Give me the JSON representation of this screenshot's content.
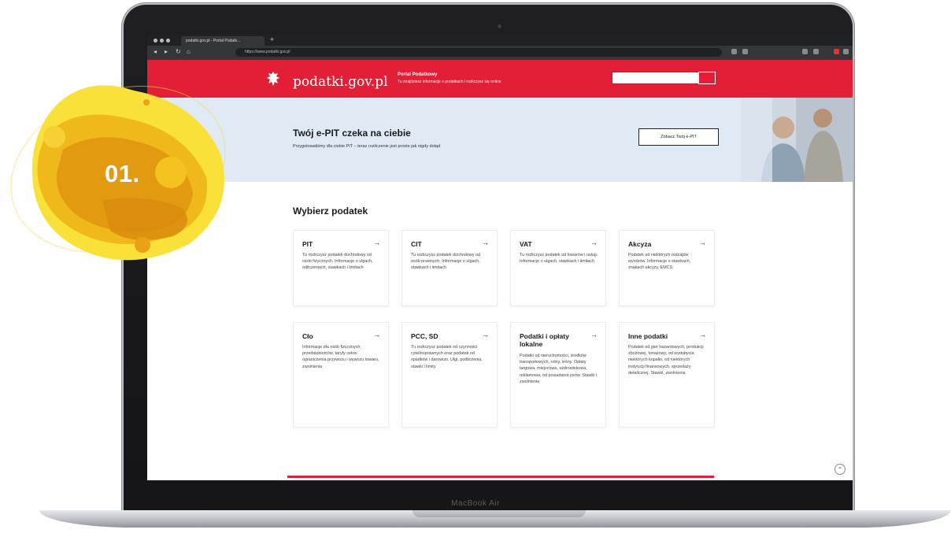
{
  "badge": {
    "label": "01."
  },
  "device": {
    "model_label": "MacBook Air"
  },
  "browser": {
    "tab_title": "podatki.gov.pl - Portal Podatk...",
    "new_tab": "+",
    "url": "https://www.podatki.gov.pl"
  },
  "site": {
    "logo_text": "podatki.gov.pl",
    "portal_title": "Portal Podatkowy",
    "portal_subtitle": "Tu znajdziesz informacje o podatkach i rozliczysz się online"
  },
  "banner": {
    "title": "Twój e-PIT czeka na ciebie",
    "subtitle": "Przygotowaliśmy dla ciebie PIT – teraz rozliczenie jest proste jak nigdy dotąd",
    "button_label": "Zobacz Twój e-PIT"
  },
  "section": {
    "title": "Wybierz podatek"
  },
  "cards": [
    {
      "title": "PIT",
      "arrow": "→",
      "desc": "Tu rozliczysz podatek dochodowy od osób fizycznych. Informacje o ulgach, odliczeniach, stawkach i limitach"
    },
    {
      "title": "CIT",
      "arrow": "→",
      "desc": "Tu rozliczysz podatek dochodowy od osób prawnych. Informacje o ulgach, stawkach i limitach"
    },
    {
      "title": "VAT",
      "arrow": "→",
      "desc": "Tu rozliczysz podatek od towarów i usług. Informacje o ulgach, stawkach i limitach"
    },
    {
      "title": "Akcyza",
      "arrow": "→",
      "desc": "Podatek od niektórych rodzajów wyrobów. Informacje o stawkach, znakach akcyzy, EMCS"
    },
    {
      "title": "Cło",
      "arrow": "→",
      "desc": "Informacje dla osób fizycznych, przedsiębiorców, taryfy celne, ograniczenia przywozu i wywozu towaru, zwolnienia"
    },
    {
      "title": "PCC, SD",
      "arrow": "→",
      "desc": "Tu rozliczysz podatek od czynności cywilnoprawnych oraz podatek od spadków i darowizn. Ulgi, podliczenia, stawki i limity"
    },
    {
      "title": "Podatki i opłaty lokalne",
      "arrow": "→",
      "desc": "Podatki od nieruchomości, środków transportowych, rolny, leśny. Opłaty targowa, miejscowa, uzdrowiskowa, reklamowa, od posiadania psów. Stawki i zwolnienia"
    },
    {
      "title": "Inne podatki",
      "arrow": "→",
      "desc": "Podatek od gier hazardowych, produkcji zbożowej, tonażowy, od wydobycia niektórych kopalin, od niektórych instytucji finansowych, sprzedaży detalicznej. Stawki, zwolnienia"
    }
  ],
  "scroll_top": {
    "label": "⌃"
  },
  "colors": {
    "brand_red": "#e21f36",
    "banner_bg": "#dfeaf4",
    "badge_yellow": "#f5c400"
  }
}
